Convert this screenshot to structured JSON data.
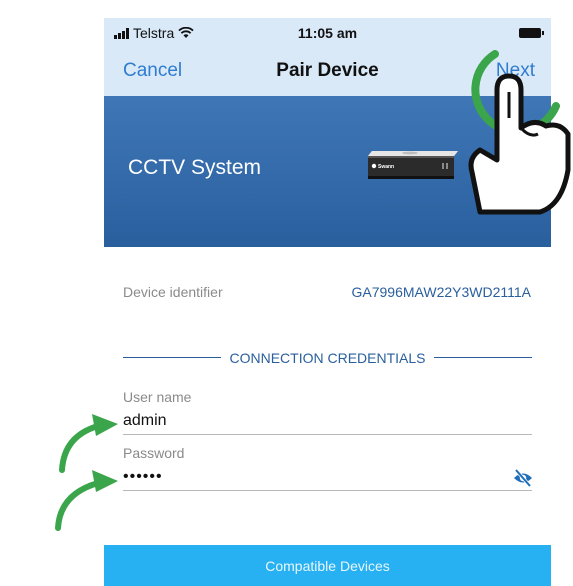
{
  "status_bar": {
    "carrier": "Telstra",
    "time": "11:05 am",
    "icons": [
      "signal-icon",
      "wifi-icon",
      "battery-icon"
    ]
  },
  "nav": {
    "cancel_label": "Cancel",
    "title": "Pair Device",
    "next_label": "Next"
  },
  "hero": {
    "title": "CCTV System",
    "device_brand": "Swann"
  },
  "device": {
    "identifier_label": "Device identifier",
    "identifier_value": "GA7996MAW22Y3WD2111A"
  },
  "credentials": {
    "section_title": "CONNECTION CREDENTIALS",
    "username_label": "User name",
    "username_value": "admin",
    "password_label": "Password",
    "password_value": "••••••"
  },
  "footer": {
    "compatible_label": "Compatible Devices"
  },
  "colors": {
    "nav_bg": "#d9e9f8",
    "link": "#2f7cd1",
    "hero": "#2a5f9e",
    "accent": "#27b1f2",
    "annotation_green": "#3aa54a"
  }
}
